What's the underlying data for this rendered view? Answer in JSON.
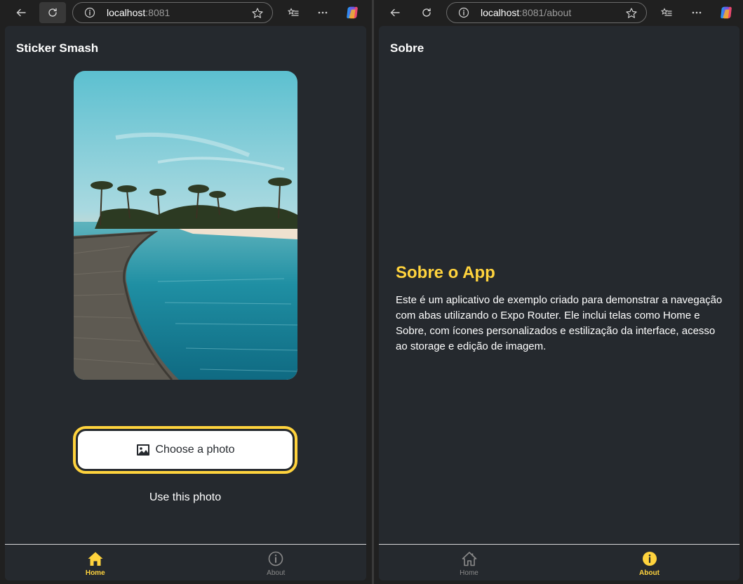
{
  "left": {
    "url_host": "localhost",
    "url_rest": ":8081",
    "header_title": "Sticker Smash",
    "choose_button": "Choose a photo",
    "use_button": "Use this photo",
    "tabs": [
      {
        "label": "Home",
        "icon": "home-icon",
        "active": true
      },
      {
        "label": "About",
        "icon": "info-icon",
        "active": false
      }
    ]
  },
  "right": {
    "url_host": "localhost",
    "url_rest": ":8081/about",
    "header_title": "Sobre",
    "about_title": "Sobre o App",
    "about_text": "Este é um aplicativo de exemplo criado para demonstrar a navegação com abas utilizando o Expo Router. Ele inclui telas como Home e Sobre, com ícones personalizados e estilização da interface, acesso ao storage e edição de imagem.",
    "tabs": [
      {
        "label": "Home",
        "icon": "home-outline-icon",
        "active": false
      },
      {
        "label": "About",
        "icon": "info-filled-icon",
        "active": true
      }
    ]
  },
  "colors": {
    "accent": "#ffd33d",
    "app_bg": "#25292e",
    "browser_bg": "#202020"
  }
}
